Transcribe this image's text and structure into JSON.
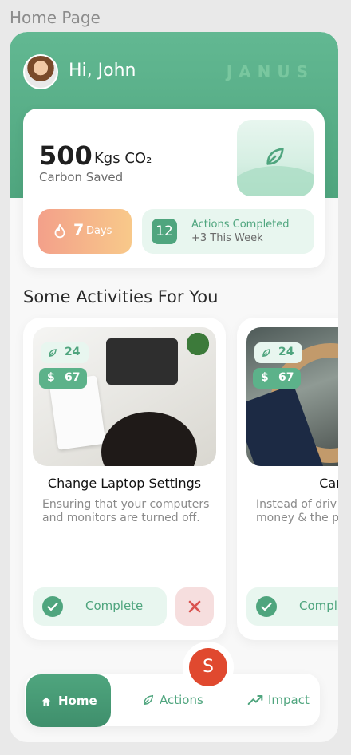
{
  "frame": {
    "label": "Home Page"
  },
  "header": {
    "greeting": "Hi, John",
    "brand": "JANUS"
  },
  "summary": {
    "carbon_value": "500",
    "carbon_unit": "Kgs CO₂",
    "carbon_label": "Carbon Saved",
    "days_count": "7",
    "days_label": "Days",
    "actions_count": "12",
    "actions_title": "Actions Completed",
    "actions_sub": "+3 This Week"
  },
  "section": {
    "title": "Some Activities For You"
  },
  "activities": [
    {
      "points": "24",
      "currency": "$",
      "amount": "67",
      "title": "Change Laptop Settings",
      "description": "Ensuring that your computers and monitors are turned off.",
      "complete_label": "Complete"
    },
    {
      "points": "24",
      "currency": "$",
      "amount": "67",
      "title": "Carpo",
      "description": "Instead of driv pool and save money & the p",
      "complete_label": "Compl"
    }
  ],
  "nav": {
    "home": "Home",
    "actions": "Actions",
    "impact": "Impact"
  },
  "fab": {
    "initial": "S"
  },
  "colors": {
    "primary": "#4fa57e",
    "accent": "#e0492f",
    "light": "#e8f6ef"
  }
}
